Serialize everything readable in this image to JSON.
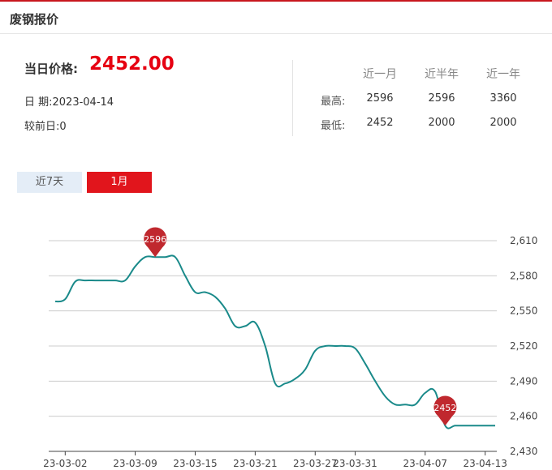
{
  "header": {
    "title": "废钢报价"
  },
  "current": {
    "price_label": "当日价格:",
    "price_value": "2452.00",
    "date_text": "日 期:2023-04-14",
    "change_text": "较前日:0"
  },
  "stats": {
    "headers": [
      "近一月",
      "近半年",
      "近一年"
    ],
    "rows": [
      {
        "label": "最高:",
        "values": [
          "2596",
          "2596",
          "3360"
        ]
      },
      {
        "label": "最低:",
        "values": [
          "2452",
          "2000",
          "2000"
        ]
      }
    ]
  },
  "tabs": [
    {
      "label": "近7天",
      "active": false
    },
    {
      "label": "1月",
      "active": true
    }
  ],
  "colors": {
    "accent": "#e1151c",
    "line": "#1a8a8a",
    "pin": "#c0282e",
    "grid": "#cccccc"
  },
  "chart_data": {
    "type": "line",
    "title": "",
    "xlabel": "",
    "ylabel": "",
    "x_ticks": [
      "23-03-02",
      "23-03-09",
      "23-03-15",
      "23-03-21",
      "23-03-27",
      "23-03-31",
      "23-04-07",
      "23-04-13"
    ],
    "y_ticks": [
      "2,610",
      "2,580",
      "2,550",
      "2,520",
      "2,490",
      "2,460",
      "2,430"
    ],
    "ylim": [
      2430,
      2610
    ],
    "x": [
      "03-01",
      "03-02",
      "03-03",
      "03-04",
      "03-05",
      "03-06",
      "03-07",
      "03-08",
      "03-09",
      "03-10",
      "03-11",
      "03-12",
      "03-13",
      "03-14",
      "03-15",
      "03-16",
      "03-17",
      "03-18",
      "03-19",
      "03-20",
      "03-21",
      "03-22",
      "03-23",
      "03-24",
      "03-25",
      "03-26",
      "03-27",
      "03-28",
      "03-29",
      "03-30",
      "03-31",
      "04-01",
      "04-02",
      "04-03",
      "04-04",
      "04-05",
      "04-06",
      "04-07",
      "04-08",
      "04-09",
      "04-10",
      "04-11",
      "04-12",
      "04-13",
      "04-14"
    ],
    "series": [
      {
        "values": [
          2558,
          2560,
          2575,
          2576,
          2576,
          2576,
          2576,
          2576,
          2588,
          2596,
          2596,
          2596,
          2596,
          2580,
          2566,
          2566,
          2562,
          2552,
          2537,
          2537,
          2540,
          2520,
          2488,
          2488,
          2492,
          2500,
          2516,
          2520,
          2520,
          2520,
          2518,
          2505,
          2490,
          2477,
          2470,
          2470,
          2470,
          2480,
          2481,
          2452,
          2452,
          2452,
          2452,
          2452,
          2452
        ]
      }
    ],
    "markers": [
      {
        "label": "2596",
        "x": "03-11",
        "y": 2596
      },
      {
        "label": "2452",
        "x": "04-09",
        "y": 2452
      }
    ],
    "grid": true
  }
}
